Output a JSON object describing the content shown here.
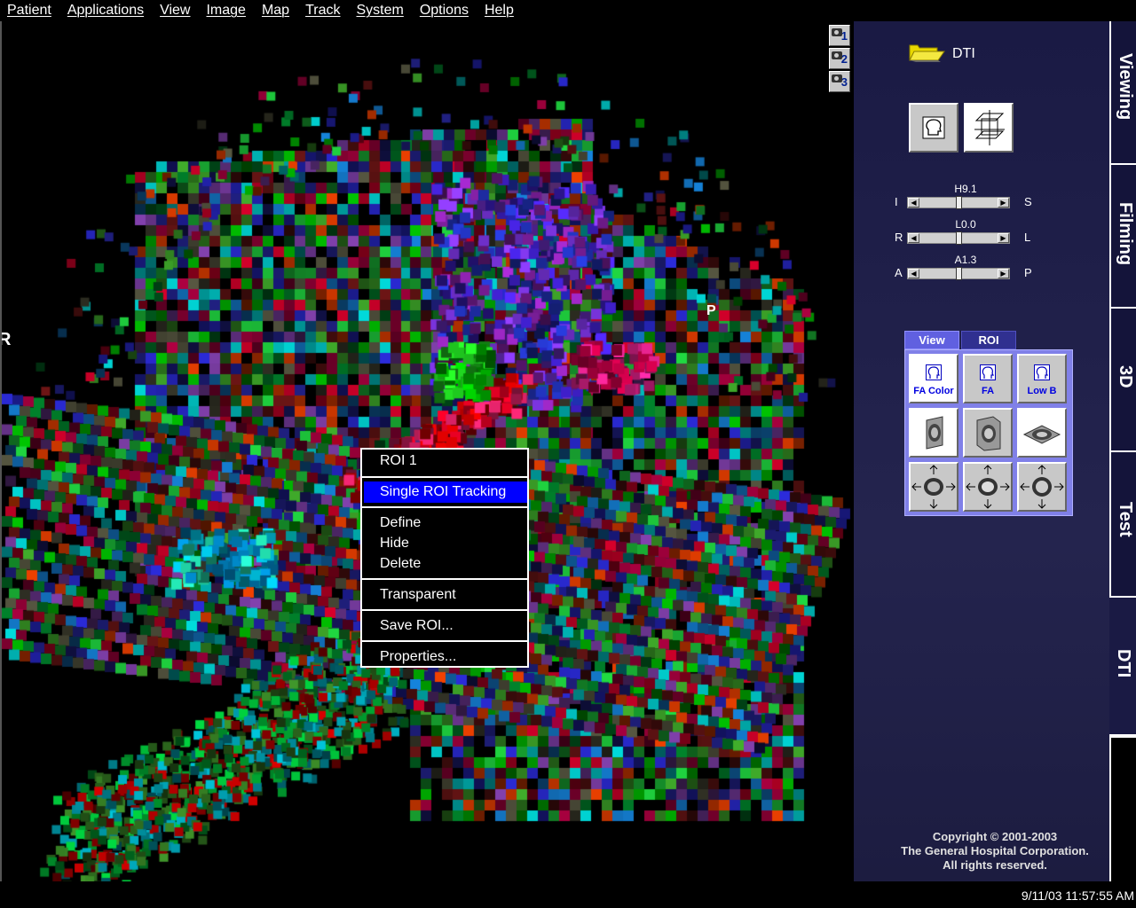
{
  "menu": [
    "Patient",
    "Applications",
    "View",
    "Image",
    "Map",
    "Track",
    "System",
    "Options",
    "Help"
  ],
  "viewport": {
    "orientation_left": "R",
    "orientation_right": "P",
    "snapshot_buttons": [
      "1",
      "2",
      "3"
    ]
  },
  "context_menu": {
    "items": [
      {
        "label": "ROI 1",
        "highlight": false
      },
      {
        "label": "Single ROI Tracking",
        "highlight": true
      },
      {
        "label": "Define",
        "highlight": false
      },
      {
        "label": "Hide",
        "highlight": false
      },
      {
        "label": "Delete",
        "highlight": false
      },
      {
        "label": "Transparent",
        "highlight": false
      },
      {
        "label": "Save ROI...",
        "highlight": false
      },
      {
        "label": "Properties...",
        "highlight": false
      }
    ]
  },
  "panel": {
    "folder_label": "DTI",
    "sliders": [
      {
        "value": "H9.1",
        "left": "I",
        "right": "S",
        "position": 0.5
      },
      {
        "value": "L0.0",
        "left": "R",
        "right": "L",
        "position": 0.5
      },
      {
        "value": "A1.3",
        "left": "A",
        "right": "P",
        "position": 0.5
      }
    ],
    "tabs": {
      "view": "View",
      "roi": "ROI"
    },
    "view_buttons": [
      "FA Color",
      "FA",
      "Low B"
    ]
  },
  "side_tabs": [
    "Viewing",
    "Filming",
    "3D",
    "Test",
    "DTI"
  ],
  "copyright": {
    "line1": "Copyright © 2001-2003",
    "line2": "The General Hospital Corporation.",
    "line3": "All rights reserved."
  },
  "status": {
    "timestamp": "9/11/03 11:57:55 AM"
  },
  "colors": {
    "menu_highlight": "#0000ff",
    "panel_bg": "#1a1a44",
    "view_panel": "#8080e8"
  }
}
